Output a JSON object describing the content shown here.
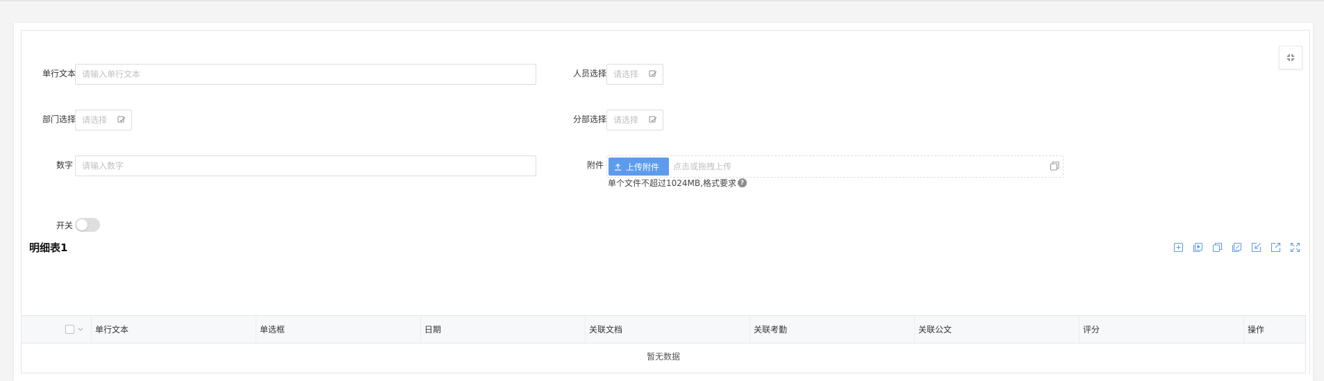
{
  "form": {
    "single_text": {
      "label": "单行文本",
      "placeholder": "请输入单行文本"
    },
    "person_select": {
      "label": "人员选择",
      "placeholder": "请选择"
    },
    "dept_select": {
      "label": "部门选择",
      "placeholder": "请选择"
    },
    "branch_select": {
      "label": "分部选择",
      "placeholder": "请选择"
    },
    "number": {
      "label": "数字",
      "placeholder": "请输入数字"
    },
    "attachment": {
      "label": "附件",
      "button_label": "上传附件",
      "placeholder": "点击或拖拽上传",
      "hint": "单个文件不超过1024MB,格式要求",
      "help_glyph": "?"
    },
    "switch": {
      "label": "开关",
      "checked": false
    }
  },
  "detail_table": {
    "title": "明细表1",
    "toolbar_icons": [
      "add-row-icon",
      "insert-row-icon",
      "copy-row-icon",
      "batch-edit-icon",
      "import-icon",
      "export-icon",
      "fullscreen-icon"
    ],
    "columns": [
      "单行文本",
      "单选框",
      "日期",
      "关联文档",
      "关联考勤",
      "关联公文",
      "评分",
      "操作"
    ],
    "rows": [],
    "empty_text": "暂无数据"
  },
  "colors": {
    "primary": "#5d9cec",
    "border": "#dcdcdc",
    "placeholder": "#c0c0c0",
    "table_header_bg": "#f7f8fa"
  }
}
